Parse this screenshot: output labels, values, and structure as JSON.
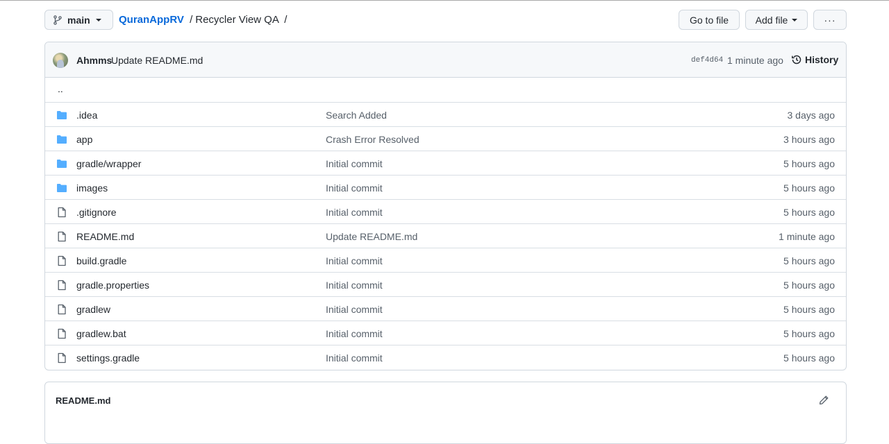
{
  "toolbar": {
    "branch": "main",
    "breadcrumb": {
      "repo": "QuranAppRV",
      "sep1": "/",
      "folder": "Recycler View QA",
      "sep2": "/"
    },
    "go_to_file": "Go to file",
    "add_file": "Add file",
    "more": "···"
  },
  "commit": {
    "author": "Ahmms",
    "message": "Update README.md",
    "sha": "def4d64",
    "time": "1 minute ago",
    "history": "History"
  },
  "parent_dir": "..",
  "files": [
    {
      "type": "folder",
      "name": ".idea",
      "message": "Search Added",
      "age": "3 days ago"
    },
    {
      "type": "folder",
      "name": "app",
      "message": "Crash Error Resolved",
      "age": "3 hours ago"
    },
    {
      "type": "folder",
      "name": "gradle/wrapper",
      "message": "Initial commit",
      "age": "5 hours ago"
    },
    {
      "type": "folder",
      "name": "images",
      "message": "Initial commit",
      "age": "5 hours ago"
    },
    {
      "type": "file",
      "name": ".gitignore",
      "message": "Initial commit",
      "age": "5 hours ago"
    },
    {
      "type": "file",
      "name": "README.md",
      "message": "Update README.md",
      "age": "1 minute ago"
    },
    {
      "type": "file",
      "name": "build.gradle",
      "message": "Initial commit",
      "age": "5 hours ago"
    },
    {
      "type": "file",
      "name": "gradle.properties",
      "message": "Initial commit",
      "age": "5 hours ago"
    },
    {
      "type": "file",
      "name": "gradlew",
      "message": "Initial commit",
      "age": "5 hours ago"
    },
    {
      "type": "file",
      "name": "gradlew.bat",
      "message": "Initial commit",
      "age": "5 hours ago"
    },
    {
      "type": "file",
      "name": "settings.gradle",
      "message": "Initial commit",
      "age": "5 hours ago"
    }
  ],
  "readme": {
    "title": "README.md"
  },
  "colors": {
    "link": "#0969da",
    "folder": "#54aeff",
    "muted": "#57606a",
    "border": "#d0d7de"
  }
}
